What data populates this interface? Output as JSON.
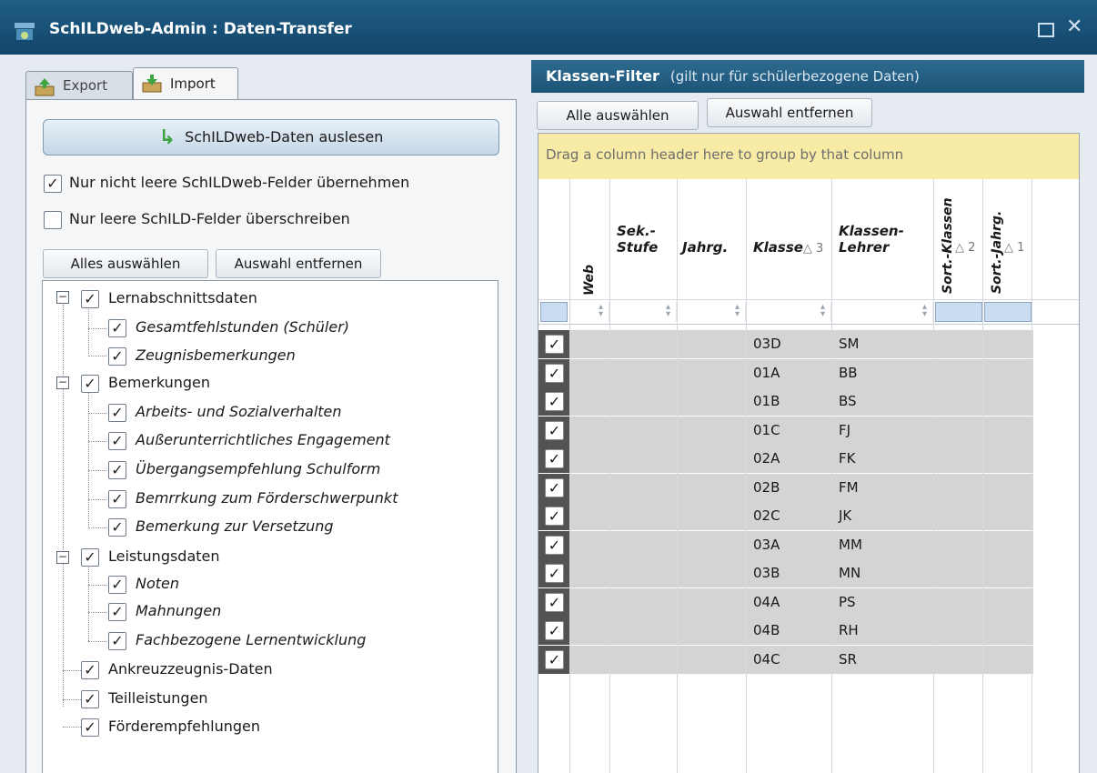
{
  "window": {
    "title": "SchILDweb-Admin : Daten-Transfer",
    "maximize_glyph": "",
    "close_glyph": "✕"
  },
  "tabs": [
    {
      "label": "Export",
      "active": false
    },
    {
      "label": "Import",
      "active": true
    }
  ],
  "import": {
    "read_button_label": "SchILDweb-Daten auslesen",
    "options": [
      {
        "label": "Nur nicht leere SchILDweb-Felder übernehmen",
        "checked": true
      },
      {
        "label": "Nur leere SchILD-Felder überschreiben",
        "checked": false
      }
    ],
    "select_all_label": "Alles auswählen",
    "deselect_label": "Auswahl entfernen",
    "tree": [
      {
        "label": "Lernabschnittsdaten",
        "checked": true,
        "expanded": true,
        "children": [
          {
            "label": "Gesamtfehlstunden (Schüler)",
            "checked": true
          },
          {
            "label": "Zeugnisbemerkungen",
            "checked": true
          }
        ]
      },
      {
        "label": "Bemerkungen",
        "checked": true,
        "expanded": true,
        "children": [
          {
            "label": "Arbeits- und Sozialverhalten",
            "checked": true
          },
          {
            "label": "Außerunterrichtliches Engagement",
            "checked": true
          },
          {
            "label": "Übergangsempfehlung Schulform",
            "checked": true
          },
          {
            "label": "Bemrrkung zum Förderschwerpunkt",
            "checked": true
          },
          {
            "label": "Bemerkung zur Versetzung",
            "checked": true
          }
        ]
      },
      {
        "label": "Leistungsdaten",
        "checked": true,
        "expanded": true,
        "children": [
          {
            "label": "Noten",
            "checked": true
          },
          {
            "label": "Mahnungen",
            "checked": true
          },
          {
            "label": "Fachbezogene Lernentwicklung",
            "checked": true
          }
        ]
      },
      {
        "label": "Ankreuzzeugnis-Daten",
        "checked": true
      },
      {
        "label": "Teilleistungen",
        "checked": true
      },
      {
        "label": "Förderempfehlungen",
        "checked": true
      }
    ]
  },
  "klassen_filter": {
    "title": "Klassen-Filter",
    "subtitle": "(gilt nur für schülerbezogene Daten)",
    "select_all_label": "Alle auswählen",
    "deselect_label": "Auswahl entfernen",
    "group_panel_text": "Drag a column header here to group by that column",
    "columns": {
      "web": "Web",
      "sek_stufe_1": "Sek.-",
      "sek_stufe_2": "Stufe",
      "jahrg": "Jahrg.",
      "klasse": "Klasse",
      "klasse_sort": "△ 3",
      "lehrer_1": "Klassen-",
      "lehrer_2": "Lehrer",
      "sort_klassen": "Sort.-Klassen",
      "sort_klassen_ind": "△ 2",
      "sort_jahrg": "Sort.-Jahrg.",
      "sort_jahrg_ind": "△ 1"
    },
    "rows": [
      {
        "checked": true,
        "klasse": "03D",
        "lehrer": "SM"
      },
      {
        "checked": true,
        "klasse": "01A",
        "lehrer": "BB"
      },
      {
        "checked": true,
        "klasse": "01B",
        "lehrer": "BS"
      },
      {
        "checked": true,
        "klasse": "01C",
        "lehrer": "FJ"
      },
      {
        "checked": true,
        "klasse": "02A",
        "lehrer": "FK"
      },
      {
        "checked": true,
        "klasse": "02B",
        "lehrer": "FM"
      },
      {
        "checked": true,
        "klasse": "02C",
        "lehrer": "JK"
      },
      {
        "checked": true,
        "klasse": "03A",
        "lehrer": "MM"
      },
      {
        "checked": true,
        "klasse": "03B",
        "lehrer": "MN"
      },
      {
        "checked": true,
        "klasse": "04A",
        "lehrer": "PS"
      },
      {
        "checked": true,
        "klasse": "04B",
        "lehrer": "RH"
      },
      {
        "checked": true,
        "klasse": "04C",
        "lehrer": "SR"
      }
    ]
  },
  "glyphs": {
    "check": "✓",
    "minus": "−",
    "spin": "▲▼"
  },
  "colors": {
    "titlebar": "#13456a",
    "header_blue": "#1d5478",
    "group_panel": "#f7eba6",
    "row_gray": "#d4d4d4",
    "read_icon": "#3fa540"
  }
}
